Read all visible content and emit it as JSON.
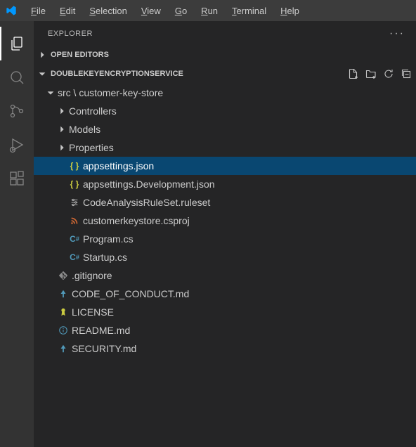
{
  "menu": {
    "items": [
      "File",
      "Edit",
      "Selection",
      "View",
      "Go",
      "Run",
      "Terminal",
      "Help"
    ]
  },
  "explorer": {
    "title": "Explorer",
    "open_editors_label": "Open Editors",
    "project_label": "DoubleKeyEncryptionService",
    "actions": {
      "new_file": "New File",
      "new_folder": "New Folder",
      "refresh": "Refresh Explorer",
      "collapse": "Collapse Folders"
    }
  },
  "tree": {
    "src_folder": "src \\ customer-key-store",
    "controllers": "Controllers",
    "models": "Models",
    "properties": "Properties",
    "appsettings": "appsettings.json",
    "appsettings_dev": "appsettings.Development.json",
    "ruleset": "CodeAnalysisRuleSet.ruleset",
    "csproj": "customerkeystore.csproj",
    "program_cs": "Program.cs",
    "startup_cs": "Startup.cs",
    "gitignore": ".gitignore",
    "coc": "CODE_OF_CONDUCT.md",
    "license": "LICENSE",
    "readme": "README.md",
    "security": "SECURITY.md"
  },
  "colors": {
    "json_braces": "#cbcb41",
    "csharp": "#519aba",
    "license": "#cbcb41",
    "markdown": "#519aba",
    "ruleset_fg": "#c5c5c5",
    "csproj": "#cc6633"
  }
}
